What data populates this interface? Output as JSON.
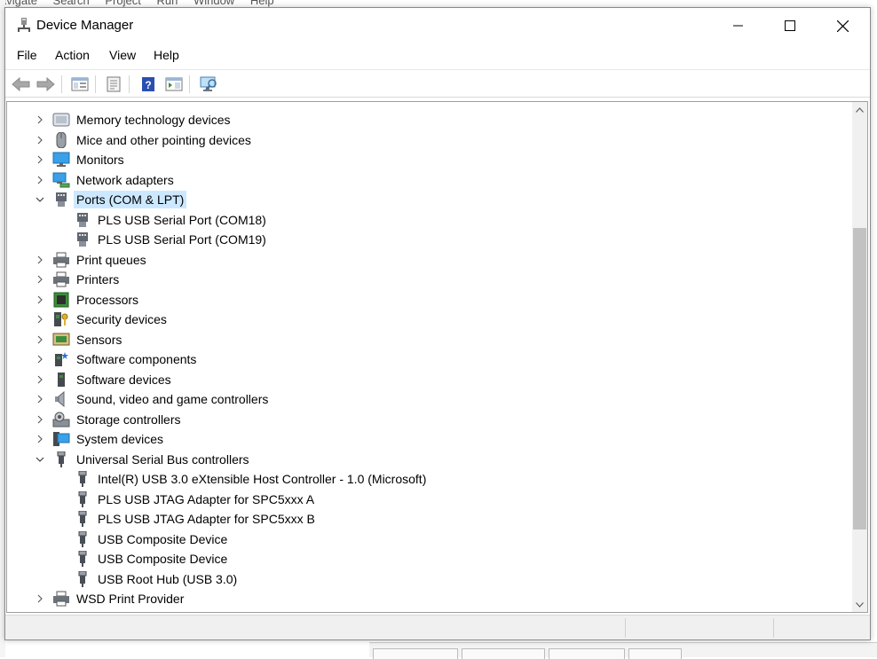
{
  "background_app": {
    "menu": [
      "avigate",
      "Search",
      "Project",
      "Run",
      "Window",
      "Help"
    ]
  },
  "window": {
    "title": "Device Manager"
  },
  "menu": {
    "items": [
      "File",
      "Action",
      "View",
      "Help"
    ]
  },
  "toolbar": {
    "buttons": [
      "back-icon",
      "forward-icon",
      "show-hide-console-tree-icon",
      "properties-icon",
      "help-icon",
      "show-action-pane-icon",
      "scan-hardware-icon"
    ]
  },
  "tree": {
    "rows": [
      {
        "label": "Memory technology devices",
        "level": 0,
        "expander": "collapsed",
        "icon": "memory-device-icon"
      },
      {
        "label": "Mice and other pointing devices",
        "level": 0,
        "expander": "collapsed",
        "icon": "mouse-icon"
      },
      {
        "label": "Monitors",
        "level": 0,
        "expander": "collapsed",
        "icon": "monitor-icon"
      },
      {
        "label": "Network adapters",
        "level": 0,
        "expander": "collapsed",
        "icon": "network-adapter-icon"
      },
      {
        "label": "Ports (COM & LPT)",
        "level": 0,
        "expander": "expanded",
        "icon": "port-icon",
        "selected": true
      },
      {
        "label": "PLS USB Serial Port (COM18)",
        "level": 1,
        "expander": "none",
        "icon": "port-icon"
      },
      {
        "label": "PLS USB Serial Port (COM19)",
        "level": 1,
        "expander": "none",
        "icon": "port-icon"
      },
      {
        "label": "Print queues",
        "level": 0,
        "expander": "collapsed",
        "icon": "printer-icon"
      },
      {
        "label": "Printers",
        "level": 0,
        "expander": "collapsed",
        "icon": "printer-icon"
      },
      {
        "label": "Processors",
        "level": 0,
        "expander": "collapsed",
        "icon": "processor-icon"
      },
      {
        "label": "Security devices",
        "level": 0,
        "expander": "collapsed",
        "icon": "security-device-icon"
      },
      {
        "label": "Sensors",
        "level": 0,
        "expander": "collapsed",
        "icon": "sensor-icon"
      },
      {
        "label": "Software components",
        "level": 0,
        "expander": "collapsed",
        "icon": "software-component-icon"
      },
      {
        "label": "Software devices",
        "level": 0,
        "expander": "collapsed",
        "icon": "software-device-icon"
      },
      {
        "label": "Sound, video and game controllers",
        "level": 0,
        "expander": "collapsed",
        "icon": "speaker-icon"
      },
      {
        "label": "Storage controllers",
        "level": 0,
        "expander": "collapsed",
        "icon": "storage-controller-icon"
      },
      {
        "label": "System devices",
        "level": 0,
        "expander": "collapsed",
        "icon": "system-device-icon"
      },
      {
        "label": "Universal Serial Bus controllers",
        "level": 0,
        "expander": "expanded",
        "icon": "usb-icon"
      },
      {
        "label": "Intel(R) USB 3.0 eXtensible Host Controller - 1.0 (Microsoft)",
        "level": 1,
        "expander": "none",
        "icon": "usb-icon"
      },
      {
        "label": "PLS USB JTAG Adapter for SPC5xxx A",
        "level": 1,
        "expander": "none",
        "icon": "usb-icon"
      },
      {
        "label": "PLS USB JTAG Adapter for SPC5xxx B",
        "level": 1,
        "expander": "none",
        "icon": "usb-icon"
      },
      {
        "label": "USB Composite Device",
        "level": 1,
        "expander": "none",
        "icon": "usb-icon"
      },
      {
        "label": "USB Composite Device",
        "level": 1,
        "expander": "none",
        "icon": "usb-icon"
      },
      {
        "label": "USB Root Hub (USB 3.0)",
        "level": 1,
        "expander": "none",
        "icon": "usb-icon"
      },
      {
        "label": "WSD Print Provider",
        "level": 0,
        "expander": "collapsed",
        "icon": "printer-icon"
      }
    ]
  },
  "scrollbar": {
    "position_fraction": 0.62
  },
  "colors": {
    "selection": "#cce8ff",
    "monitor_blue": "#3aa0e8",
    "processor_green": "#3b8f3b"
  }
}
